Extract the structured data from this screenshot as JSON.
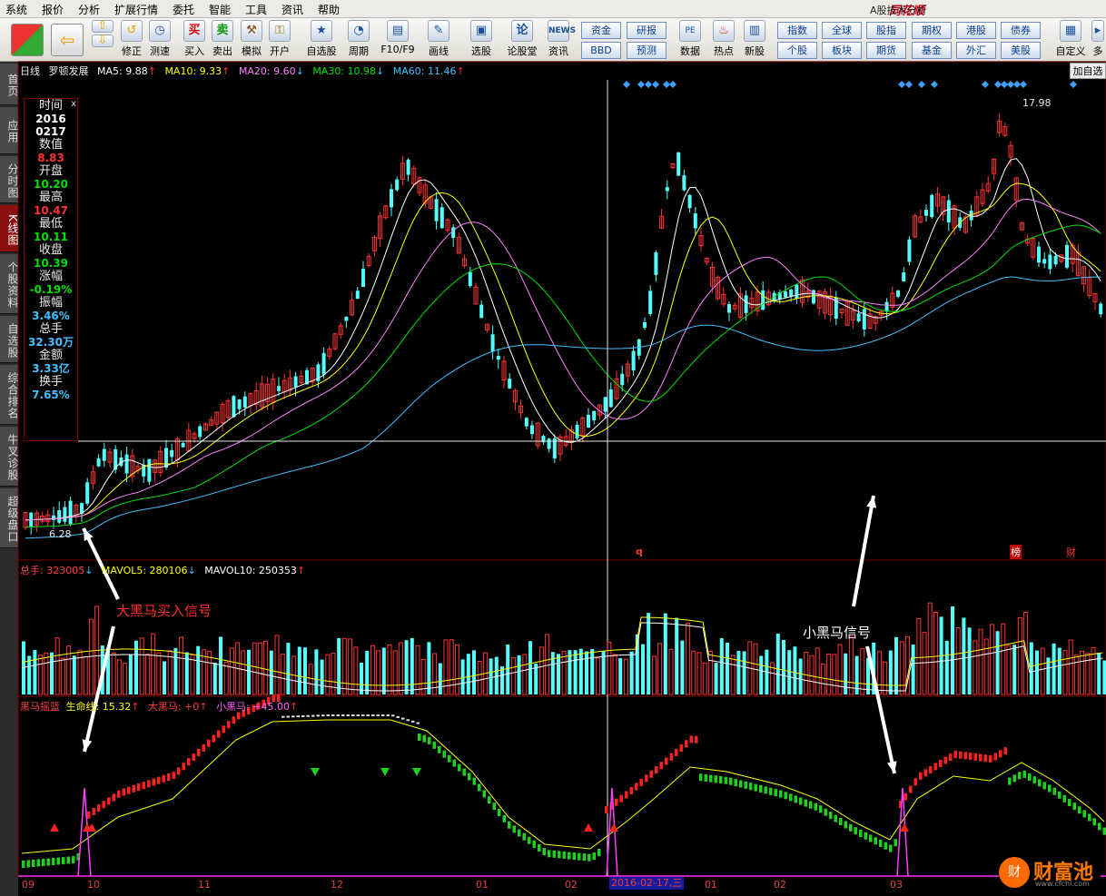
{
  "menu": [
    "系统",
    "报价",
    "分析",
    "扩展行情",
    "委托",
    "智能",
    "工具",
    "资讯",
    "帮助"
  ],
  "brand": "同花顺",
  "app_title": "A股技术分析",
  "toolbar": {
    "buttons": [
      "修正",
      "测速",
      "买入",
      "卖出",
      "模拟",
      "开户",
      "自选股",
      "周期",
      "F10/F9",
      "画线",
      "选股",
      "论股堂",
      "资讯",
      "数据",
      "热点",
      "新股",
      "自定义",
      "多"
    ],
    "quick": [
      "资金",
      "研报",
      "BBD",
      "预测",
      "指数",
      "全球",
      "股指",
      "期权",
      "港股",
      "债券",
      "个股",
      "板块",
      "期货",
      "基金",
      "外汇",
      "美股"
    ],
    "news_label": "NEWS"
  },
  "sidenav": [
    "首页",
    "应用",
    "分时图",
    "K线图",
    "个股资料",
    "自选股",
    "综合排名",
    "牛叉诊股",
    "超级盘口"
  ],
  "header": {
    "period": "日线",
    "stock": "罗顿发展",
    "ma5": "MA5: 9.88",
    "ma10": "MA10: 9.33",
    "ma20": "MA20: 9.60",
    "ma30": "MA30: 10.98",
    "ma60": "MA60: 11.46",
    "add_fav": "加自选"
  },
  "info_panel": {
    "close_glyph": "x",
    "items": [
      {
        "k": "时间",
        "v": "2016",
        "c": "#ffffff"
      },
      {
        "k": "",
        "v": "0217",
        "c": "#ffffff"
      },
      {
        "k": "数值",
        "v": "8.83",
        "c": "#ff3030"
      },
      {
        "k": "开盘",
        "v": "10.20",
        "c": "#00e000"
      },
      {
        "k": "最高",
        "v": "10.47",
        "c": "#ff3030"
      },
      {
        "k": "最低",
        "v": "10.11",
        "c": "#00e000"
      },
      {
        "k": "收盘",
        "v": "10.39",
        "c": "#00e000"
      },
      {
        "k": "涨幅",
        "v": "-0.19%",
        "c": "#00e000"
      },
      {
        "k": "振幅",
        "v": "3.46%",
        "c": "#40c0ff"
      },
      {
        "k": "总手",
        "v": "32.30万",
        "c": "#40c0ff"
      },
      {
        "k": "金额",
        "v": "3.33亿",
        "c": "#40c0ff"
      },
      {
        "k": "换手",
        "v": "7.65%",
        "c": "#40c0ff"
      }
    ]
  },
  "price_labels": {
    "high": "17.98",
    "low": "6.28",
    "q": "q",
    "rank": "榜",
    "fin": "财"
  },
  "volume_header": {
    "total": "总手: 323005",
    "mavol5": "MAVOL5: 280106",
    "mavol10": "MAVOL10: 250353"
  },
  "indicator_header": {
    "name": "黑马摇篮",
    "life": "生命线: 15.32",
    "big": "大黑马: +0",
    "small": "小黑马: +45.00"
  },
  "annotations": {
    "big_signal": "大黑马买入信号",
    "small_signal": "小黑马信号"
  },
  "x_axis": [
    "09",
    "10",
    "11",
    "12",
    "01",
    "02",
    "01",
    "02",
    "03"
  ],
  "crosshair_date": "2016-02-17,三",
  "logo": {
    "text": "财富池",
    "glyph": "财",
    "url": "www.cfchi.com"
  },
  "colors": {
    "up": "#ff3232",
    "down": "#54ffff",
    "ma5": "#ffffff",
    "ma10": "#ffff00",
    "ma20": "#ff80ff",
    "ma30": "#00e000",
    "ma60": "#40c0ff",
    "signal": "#ff40ff"
  }
}
